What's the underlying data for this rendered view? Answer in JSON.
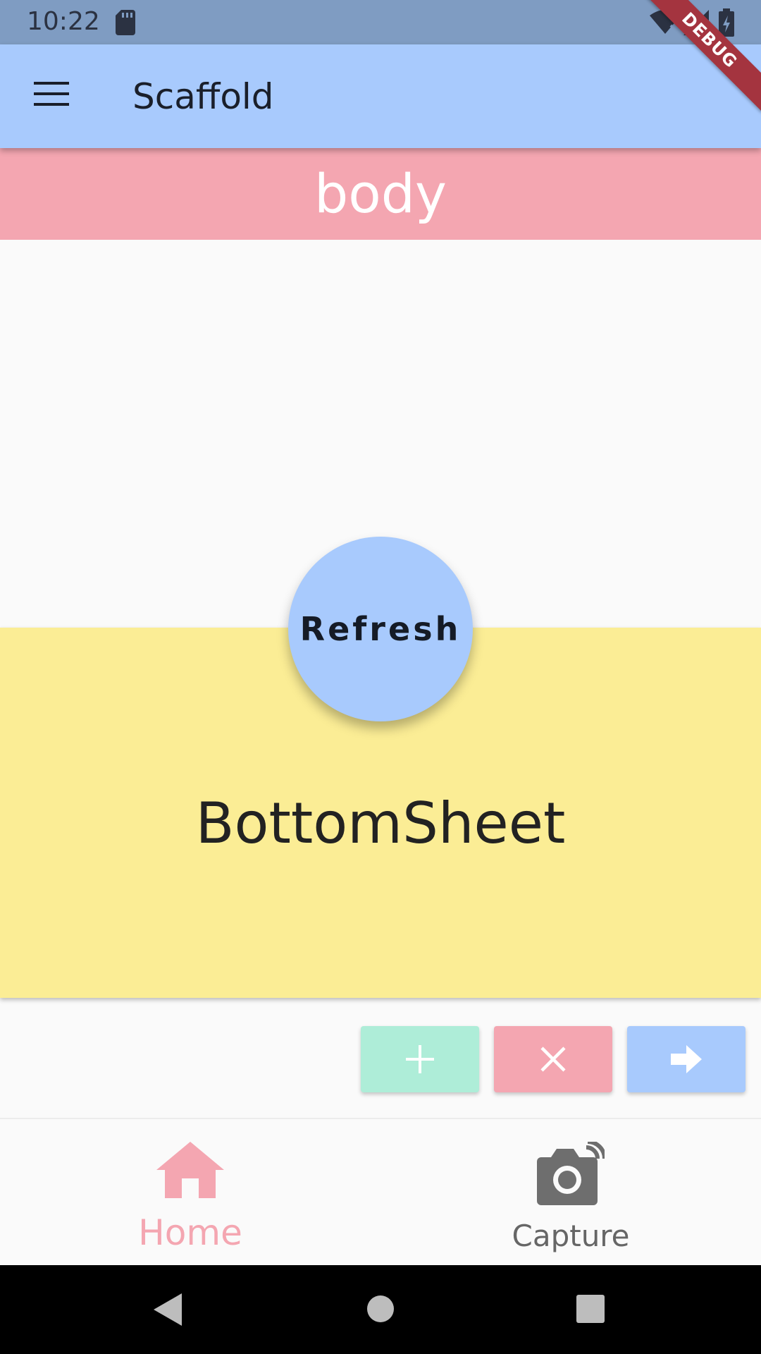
{
  "status_bar": {
    "time": "10:22",
    "icons": [
      "sd-card-icon",
      "wifi-off-icon",
      "signal-icon",
      "battery-charging-icon"
    ]
  },
  "debug_banner": "DEBUG",
  "app_bar": {
    "title": "Scaffold",
    "menu_icon": "menu-icon",
    "color": "#a8cafd"
  },
  "body": {
    "label": "body",
    "color": "#f4a6b1"
  },
  "fab": {
    "label": "Refresh",
    "color": "#a8cafd"
  },
  "bottom_sheet": {
    "label": "BottomSheet",
    "color": "#fbed95"
  },
  "actions": [
    {
      "icon": "plus-icon",
      "color": "#aeedd8"
    },
    {
      "icon": "close-icon",
      "color": "#f4a6b1"
    },
    {
      "icon": "arrow-forward-icon",
      "color": "#a8cafd"
    }
  ],
  "bottom_nav": {
    "items": [
      {
        "label": "Home",
        "icon": "home-icon",
        "selected": true,
        "color": "#f4a6b1"
      },
      {
        "label": "Capture",
        "icon": "camera-icon",
        "selected": false,
        "color": "#666666"
      }
    ]
  },
  "system_nav": {
    "icons": [
      "back-icon",
      "home-circle-icon",
      "recents-icon"
    ]
  }
}
